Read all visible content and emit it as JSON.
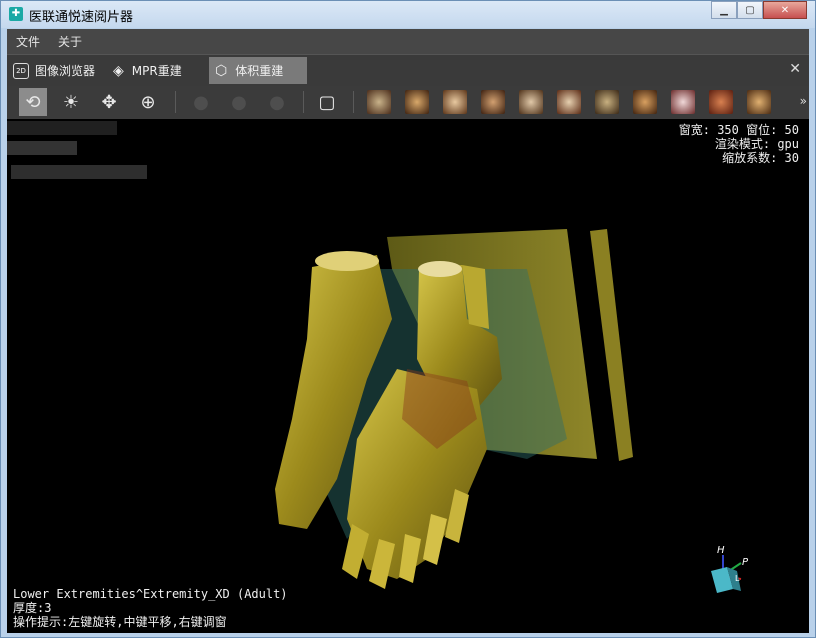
{
  "window": {
    "title": "医联通悦速阅片器",
    "min_label": "▁",
    "max_label": "▢",
    "close_label": "✕"
  },
  "menu": {
    "items": [
      "文件",
      "关于"
    ]
  },
  "tabs": [
    {
      "icon": "2D",
      "label": "图像浏览器"
    },
    {
      "icon": "mpr",
      "label": "MPR重建"
    },
    {
      "icon": "cube",
      "label": "体积重建"
    }
  ],
  "tab_close_label": "✕",
  "toolbar": {
    "tools": [
      {
        "name": "rotate-3d-tool",
        "glyph": "⟲",
        "active": true
      },
      {
        "name": "window-level-tool",
        "glyph": "☀"
      },
      {
        "name": "pan-tool",
        "glyph": "✥"
      },
      {
        "name": "zoom-tool",
        "glyph": "⊕"
      },
      {
        "name": "head-preset-tool",
        "glyph": "●",
        "disabled": true
      },
      {
        "name": "head-preset-tool-2",
        "glyph": "●",
        "disabled": true
      },
      {
        "name": "head-preset-tool-3",
        "glyph": "●",
        "disabled": true
      },
      {
        "name": "cube-box-tool",
        "glyph": "▢"
      }
    ],
    "presets": [
      "ribcage",
      "pelvis",
      "hip",
      "skull",
      "spine",
      "pelvis-bone",
      "head",
      "torso",
      "joints",
      "body-skin",
      "chest"
    ],
    "more_label": "»"
  },
  "viewport": {
    "window_info": "窗宽: 350 窗位: 50",
    "render_mode": "渲染模式: gpu",
    "zoom_factor": "缩放系数: 30",
    "series_name": "Lower Extremities^Extremity_XD (Adult)",
    "thickness": "厚度:3",
    "hint": "操作提示:左键旋转,中键平移,右键调窗",
    "orient_h": "H",
    "orient_p": "P",
    "orient_l": "L"
  },
  "colors": {
    "bone": "#b5a32a",
    "tissue": "#2f6e6a",
    "background": "#000000"
  }
}
